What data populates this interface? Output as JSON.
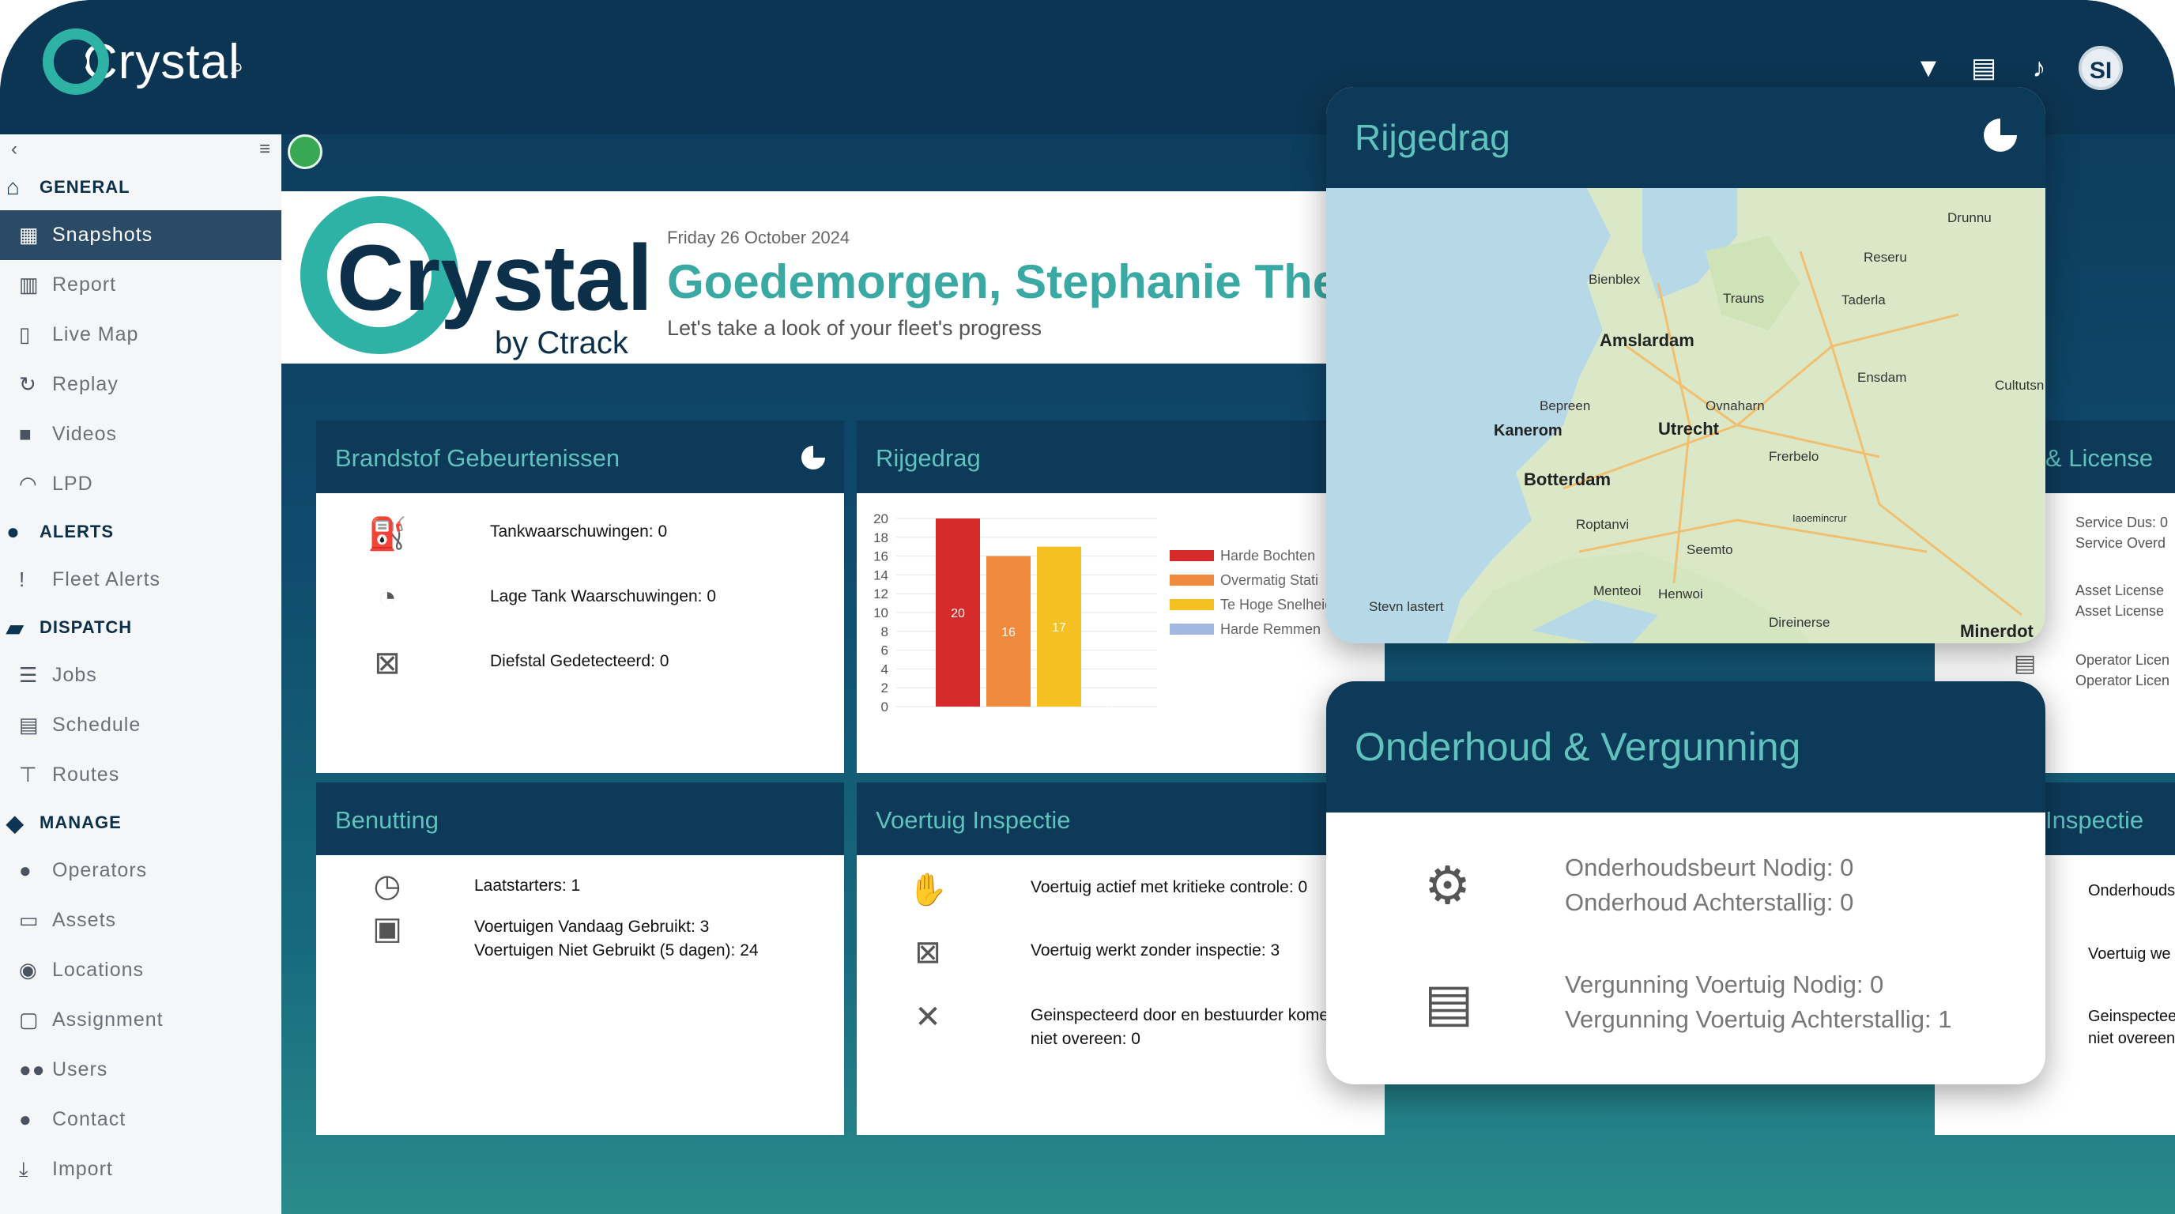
{
  "app": {
    "name": "Crystal",
    "avatar_initials": "SI"
  },
  "topbar": {
    "icons": [
      "search-icon",
      "filter-icon",
      "chat-icon",
      "bell-icon"
    ]
  },
  "sidebar": {
    "sections": [
      {
        "label": "GENERAL",
        "icon": "home-icon",
        "items": [
          {
            "label": "Snapshots",
            "icon": "grid-icon",
            "active": true
          },
          {
            "label": "Report",
            "icon": "chart-icon"
          },
          {
            "label": "Live Map",
            "icon": "map-icon"
          },
          {
            "label": "Replay",
            "icon": "replay-icon"
          },
          {
            "label": "Videos",
            "icon": "video-icon"
          },
          {
            "label": "LPD",
            "icon": "wifi-icon"
          }
        ]
      },
      {
        "label": "ALERTS",
        "icon": "info-icon",
        "items": [
          {
            "label": "Fleet Alerts",
            "icon": "exclamation-icon"
          }
        ]
      },
      {
        "label": "DISPATCH",
        "icon": "truck-icon",
        "items": [
          {
            "label": "Jobs",
            "icon": "checklist-icon"
          },
          {
            "label": "Schedule",
            "icon": "calendar-icon"
          },
          {
            "label": "Routes",
            "icon": "signpost-icon"
          }
        ]
      },
      {
        "label": "MANAGE",
        "icon": "manage-icon",
        "items": [
          {
            "label": "Operators",
            "icon": "person-icon"
          },
          {
            "label": "Assets",
            "icon": "car-icon"
          },
          {
            "label": "Locations",
            "icon": "pin-icon"
          },
          {
            "label": "Assignment",
            "icon": "assignment-icon"
          },
          {
            "label": "Users",
            "icon": "users-icon"
          },
          {
            "label": "Contact",
            "icon": "contact-icon"
          },
          {
            "label": "Import",
            "icon": "import-icon"
          }
        ]
      }
    ]
  },
  "welcome": {
    "logo_text": "Crystal",
    "logo_sub": "by Ctrack",
    "date": "Friday 26 October 2024",
    "greeting": "Goedemorgen, Stephanie The",
    "subtitle": "Let's take a look of your fleet's progress"
  },
  "cards": {
    "brandstof": {
      "title": "Brandstof Gebeurtenissen",
      "rows": [
        "Tankwaarschuwingen: 0",
        "Lage Tank Waarschuwingen: 0",
        "Diefstal Gedetecteerd: 0"
      ]
    },
    "rijgedrag": {
      "title": "Rijgedrag"
    },
    "license": {
      "title": "& License",
      "lines": [
        "Service Dus: 0",
        "Service Overd",
        "Asset License",
        "Asset License",
        "Operator Licen",
        "Operator Licen"
      ]
    },
    "benutting": {
      "title": "Benutting",
      "rows": [
        "Laatstarters: 1",
        "Voertuigen Vandaag Gebruikt: 3",
        "Voertuigen Niet Gebruikt (5 dagen): 24"
      ]
    },
    "inspectie": {
      "title": "Voertuig Inspectie",
      "rows": [
        "Voertuig actief met kritieke controle: 0",
        "Voertuig werkt zonder inspectie: 3",
        "Geinspecteerd door en bestuurder komen",
        "niet overeen: 0"
      ]
    },
    "inspectie_right": {
      "title": "Inspectie",
      "lines": [
        "Onderhouds",
        "Voertuig we",
        "Geinspectee",
        "niet overeen"
      ]
    }
  },
  "chart_data": {
    "type": "bar",
    "categories": [
      "Harde Bochten",
      "Overmatig Stati",
      "Te Hoge Snelheid",
      "Harde Remmen"
    ],
    "values": [
      20,
      16,
      17,
      0
    ],
    "ylim": [
      0,
      20
    ],
    "yticks": [
      "20",
      "18",
      "16",
      "14",
      "12",
      "10",
      "8",
      "6",
      "4",
      "2",
      "0"
    ],
    "legend": [
      "Harde Bochten",
      "Overmatig Stati",
      "Te Hoge Snelheid",
      "Harde Remmen"
    ],
    "colors": [
      "#d42a2a",
      "#f08a3c",
      "#f5c122",
      "#a3b8e0"
    ],
    "legend_position": "right"
  },
  "popups": {
    "map": {
      "title": "Rijgedrag",
      "places": [
        "Drunnu",
        "Bienblex",
        "Reseru",
        "Trauns",
        "Taderla",
        "Amslardam",
        "Ensdam",
        "Cultutsn",
        "Bepreen",
        "Ovnaharn",
        "Kanerom",
        "Utrecht",
        "Frerbelo",
        "Botterdam",
        "Roptanvi",
        "Iaoemincrur",
        "Seemto",
        "Menteoi",
        "Henwoi",
        "Stevn lastert",
        "Direinerse",
        "Minerdot"
      ]
    },
    "onderhoud": {
      "title": "Onderhoud & Vergunning",
      "rows": [
        [
          "Onderhoudsbeurt Nodig: 0",
          "Onderhoud Achterstallig: 0"
        ],
        [
          "Vergunning Voertuig Nodig: 0",
          "Vergunning Voertuig Achterstallig: 1"
        ]
      ]
    }
  }
}
